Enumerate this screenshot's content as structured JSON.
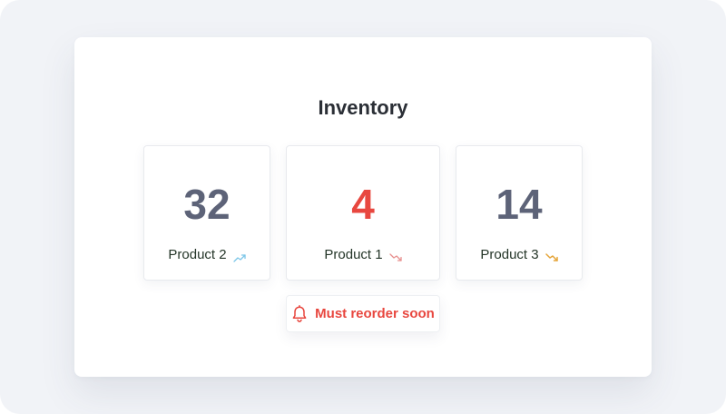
{
  "title": "Inventory",
  "colors": {
    "neutral_count": "#5d6378",
    "alert_red": "#e8473f",
    "trend_up": "#7cc6e8",
    "trend_down_warning": "#e8908f",
    "trend_down_caution": "#e5a53a",
    "label_text": "#243528"
  },
  "cards": [
    {
      "count": "32",
      "label": "Product 2",
      "trend_icon": "trending-up-icon"
    },
    {
      "count": "4",
      "label": "Product 1",
      "trend_icon": "trending-down-icon"
    },
    {
      "count": "14",
      "label": "Product 3",
      "trend_icon": "trending-down-icon"
    }
  ],
  "alert": {
    "text": "Must reorder soon",
    "icon": "bell-icon"
  }
}
